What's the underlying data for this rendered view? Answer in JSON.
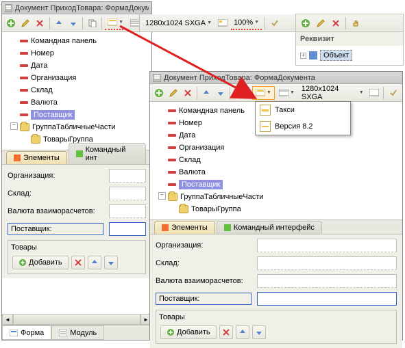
{
  "win1": {
    "title": "Документ ПриходТовара: ФормаДокумента",
    "resolution": "1280x1024 SXGA",
    "zoom": "100%",
    "tree": {
      "root": "Командная панель",
      "items": [
        "Номер",
        "Дата",
        "Организация",
        "Склад",
        "Валюта",
        "Поставщик"
      ],
      "group": "ГруппаТабличныеЧасти",
      "sub": "ТоварыГруппа"
    },
    "tabs": {
      "t1": "Элементы",
      "t2": "Командный инт"
    },
    "form": {
      "org": "Организация:",
      "sklad": "Склад:",
      "valuta": "Валюта взаиморасчетов:",
      "post": "Поставщик:"
    },
    "tovary": "Товары",
    "add": "Добавить",
    "btabs": {
      "t1": "Форма",
      "t2": "Модуль"
    }
  },
  "win2": {
    "title": "Документ ПриходТовара: ФормаДокумента",
    "resolution": "1280x1024 SXGA",
    "tree": {
      "root": "Командная панель",
      "items": [
        "Номер",
        "Дата",
        "Организация",
        "Склад",
        "Валюта",
        "Поставщик"
      ],
      "group": "ГруппаТабличныеЧасти",
      "sub": "ТоварыГруппа"
    },
    "tabs": {
      "t1": "Элементы",
      "t2": "Командный интерфейс"
    },
    "form": {
      "org": "Организация:",
      "sklad": "Склад:",
      "valuta": "Валюта взаиморасчетов:",
      "post": "Поставщик:"
    },
    "tovary": "Товары",
    "add": "Добавить"
  },
  "popup": {
    "taxi": "Такси",
    "v82": "Версия 8.2"
  },
  "side": {
    "header": "Реквизит",
    "obj": "Объект"
  }
}
